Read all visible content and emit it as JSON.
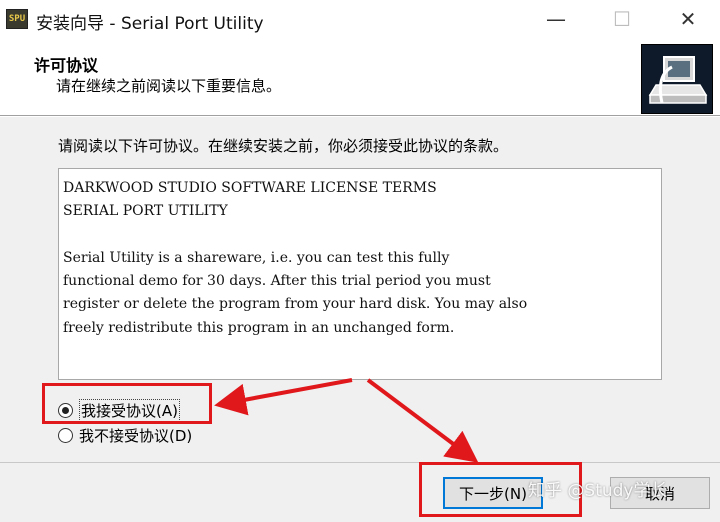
{
  "window": {
    "title": "安装向导 - Serial Port Utility",
    "app_icon_text": "SPU",
    "minimize_symbol": "—",
    "maximize_symbol": "☐",
    "close_symbol": "✕"
  },
  "header": {
    "title": "许可协议",
    "subtitle": "请在继续之前阅读以下重要信息。",
    "graphic_icon": "computer-setup-icon"
  },
  "main": {
    "instruction": "请阅读以下许可协议。在继续安装之前，你必须接受此协议的条款。",
    "license_lines": [
      "DARKWOOD STUDIO SOFTWARE LICENSE TERMS",
      "SERIAL PORT UTILITY",
      "",
      "Serial Utility is a shareware, i.e. you can test this fully",
      "functional demo for 30 days. After this trial period you must",
      "register or delete the program from your hard disk. You may also",
      "freely redistribute this program in an unchanged form."
    ],
    "accept_label": "我接受协议(A)",
    "decline_label": "我不接受协议(D)",
    "selected_option": "accept"
  },
  "footer": {
    "next_label": "下一步(N)",
    "cancel_label": "取消"
  },
  "watermark": "知乎 @Study学长",
  "colors": {
    "annotation_red": "#e0181c",
    "focus_blue": "#0078d7",
    "dialog_gray": "#f0f0f0"
  }
}
